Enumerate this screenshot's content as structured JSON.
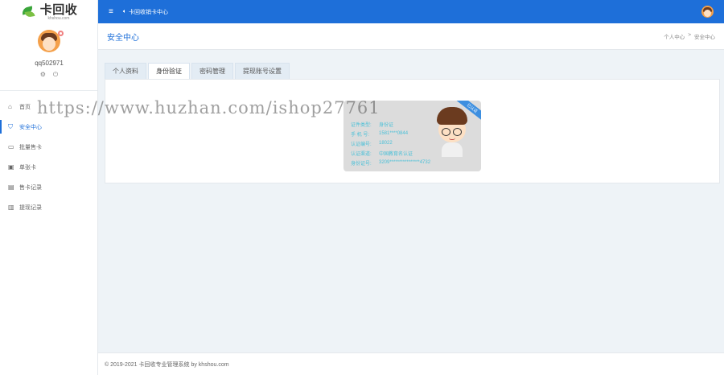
{
  "logo": {
    "cn": "卡回收",
    "en": "khshou.com"
  },
  "profile": {
    "username": "qq502971",
    "settings_icon": "gear-icon",
    "power_icon": "power-icon"
  },
  "sidebar": {
    "items": [
      {
        "label": "首页",
        "icon": "home-icon",
        "active": false
      },
      {
        "label": "安全中心",
        "icon": "shield-icon",
        "active": true
      },
      {
        "label": "批量售卡",
        "icon": "card-icon",
        "active": false
      },
      {
        "label": "单张卡",
        "icon": "single-card-icon",
        "active": false
      },
      {
        "label": "售卡记录",
        "icon": "record-icon",
        "active": false
      },
      {
        "label": "提现记录",
        "icon": "withdraw-icon",
        "active": false
      }
    ]
  },
  "topbar": {
    "announcement": "卡回收销卡中心"
  },
  "page": {
    "title": "安全中心"
  },
  "breadcrumb": {
    "home": "个人中心",
    "separator": ">",
    "current": "安全中心"
  },
  "tabs": [
    {
      "label": "个人资料",
      "active": false
    },
    {
      "label": "身份验证",
      "active": true
    },
    {
      "label": "密码管理",
      "active": false
    },
    {
      "label": "提现账号设置",
      "active": false
    }
  ],
  "idcard": {
    "ribbon": "已认证",
    "rows": [
      {
        "key": "证件类型:",
        "value": "身份证"
      },
      {
        "key": "手 机 号:",
        "value": "1581****0844"
      },
      {
        "key": "认证编号:",
        "value": "18022"
      },
      {
        "key": "认证渠道:",
        "value": "中国教育名认证"
      },
      {
        "key": "身份证号:",
        "value": "3209****************4732"
      }
    ]
  },
  "watermark": "https://www.huzhan.com/ishop27761",
  "footer": {
    "text": "© 2019-2021 卡回收专业管理系统 by khshou.com"
  },
  "colors": {
    "primary": "#1e6fd9",
    "card_text": "#4ac0d8",
    "ribbon": "#3d8fe0"
  }
}
